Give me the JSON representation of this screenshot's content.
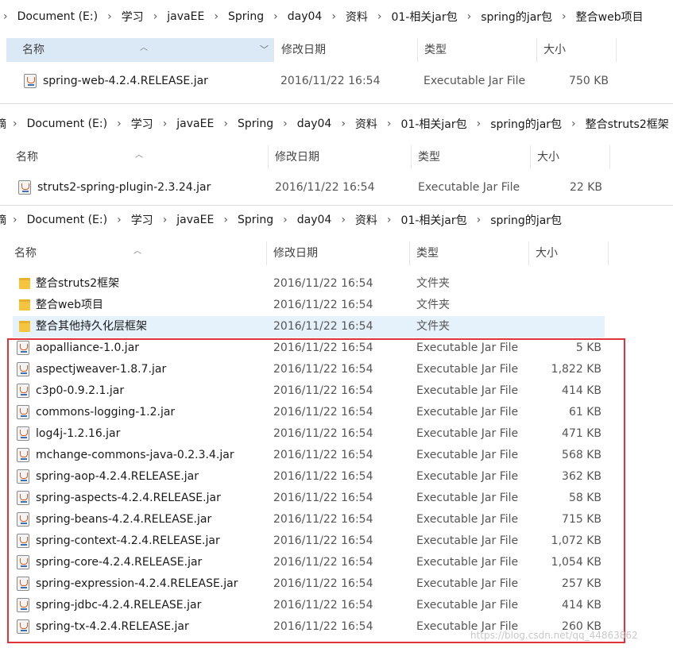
{
  "panel1": {
    "breadcrumb": [
      "Document (E:)",
      "学习",
      "javaEE",
      "Spring",
      "day04",
      "资料",
      "01-相关jar包",
      "spring的jar包",
      "整合web项目"
    ],
    "headers": {
      "name": "名称",
      "date": "修改日期",
      "type": "类型",
      "size": "大小"
    },
    "files": [
      {
        "name": "spring-web-4.2.4.RELEASE.jar",
        "date": "2016/11/22 16:54",
        "type": "Executable Jar File",
        "size": "750 KB"
      }
    ]
  },
  "panel2": {
    "breadcrumb": [
      "摘",
      "Document (E:)",
      "学习",
      "javaEE",
      "Spring",
      "day04",
      "资料",
      "01-相关jar包",
      "spring的jar包",
      "整合struts2框架"
    ],
    "headers": {
      "name": "名称",
      "date": "修改日期",
      "type": "类型",
      "size": "大小"
    },
    "files": [
      {
        "name": "struts2-spring-plugin-2.3.24.jar",
        "date": "2016/11/22 16:54",
        "type": "Executable Jar File",
        "size": "22 KB"
      }
    ]
  },
  "panel3": {
    "breadcrumb": [
      "摘",
      "Document (E:)",
      "学习",
      "javaEE",
      "Spring",
      "day04",
      "资料",
      "01-相关jar包",
      "spring的jar包"
    ],
    "headers": {
      "name": "名称",
      "date": "修改日期",
      "type": "类型",
      "size": "大小"
    },
    "folders": [
      {
        "name": "整合struts2框架",
        "date": "2016/11/22 16:54",
        "type": "文件夹"
      },
      {
        "name": "整合web项目",
        "date": "2016/11/22 16:54",
        "type": "文件夹"
      },
      {
        "name": "整合其他持久化层框架",
        "date": "2016/11/22 16:54",
        "type": "文件夹"
      }
    ],
    "files": [
      {
        "name": "aopalliance-1.0.jar",
        "date": "2016/11/22 16:54",
        "type": "Executable Jar File",
        "size": "5 KB"
      },
      {
        "name": "aspectjweaver-1.8.7.jar",
        "date": "2016/11/22 16:54",
        "type": "Executable Jar File",
        "size": "1,822 KB"
      },
      {
        "name": "c3p0-0.9.2.1.jar",
        "date": "2016/11/22 16:54",
        "type": "Executable Jar File",
        "size": "414 KB"
      },
      {
        "name": "commons-logging-1.2.jar",
        "date": "2016/11/22 16:54",
        "type": "Executable Jar File",
        "size": "61 KB"
      },
      {
        "name": "log4j-1.2.16.jar",
        "date": "2016/11/22 16:54",
        "type": "Executable Jar File",
        "size": "471 KB"
      },
      {
        "name": "mchange-commons-java-0.2.3.4.jar",
        "date": "2016/11/22 16:54",
        "type": "Executable Jar File",
        "size": "568 KB"
      },
      {
        "name": "spring-aop-4.2.4.RELEASE.jar",
        "date": "2016/11/22 16:54",
        "type": "Executable Jar File",
        "size": "362 KB"
      },
      {
        "name": "spring-aspects-4.2.4.RELEASE.jar",
        "date": "2016/11/22 16:54",
        "type": "Executable Jar File",
        "size": "58 KB"
      },
      {
        "name": "spring-beans-4.2.4.RELEASE.jar",
        "date": "2016/11/22 16:54",
        "type": "Executable Jar File",
        "size": "715 KB"
      },
      {
        "name": "spring-context-4.2.4.RELEASE.jar",
        "date": "2016/11/22 16:54",
        "type": "Executable Jar File",
        "size": "1,072 KB"
      },
      {
        "name": "spring-core-4.2.4.RELEASE.jar",
        "date": "2016/11/22 16:54",
        "type": "Executable Jar File",
        "size": "1,054 KB"
      },
      {
        "name": "spring-expression-4.2.4.RELEASE.jar",
        "date": "2016/11/22 16:54",
        "type": "Executable Jar File",
        "size": "257 KB"
      },
      {
        "name": "spring-jdbc-4.2.4.RELEASE.jar",
        "date": "2016/11/22 16:54",
        "type": "Executable Jar File",
        "size": "414 KB"
      },
      {
        "name": "spring-tx-4.2.4.RELEASE.jar",
        "date": "2016/11/22 16:54",
        "type": "Executable Jar File",
        "size": "260 KB"
      }
    ]
  },
  "watermark": "https://blog.csdn.net/qq_44863862",
  "colors": {
    "highlight_box": "#e0353d",
    "selected_header": "#dbe9f7",
    "hover_row": "#e5f1fb"
  }
}
